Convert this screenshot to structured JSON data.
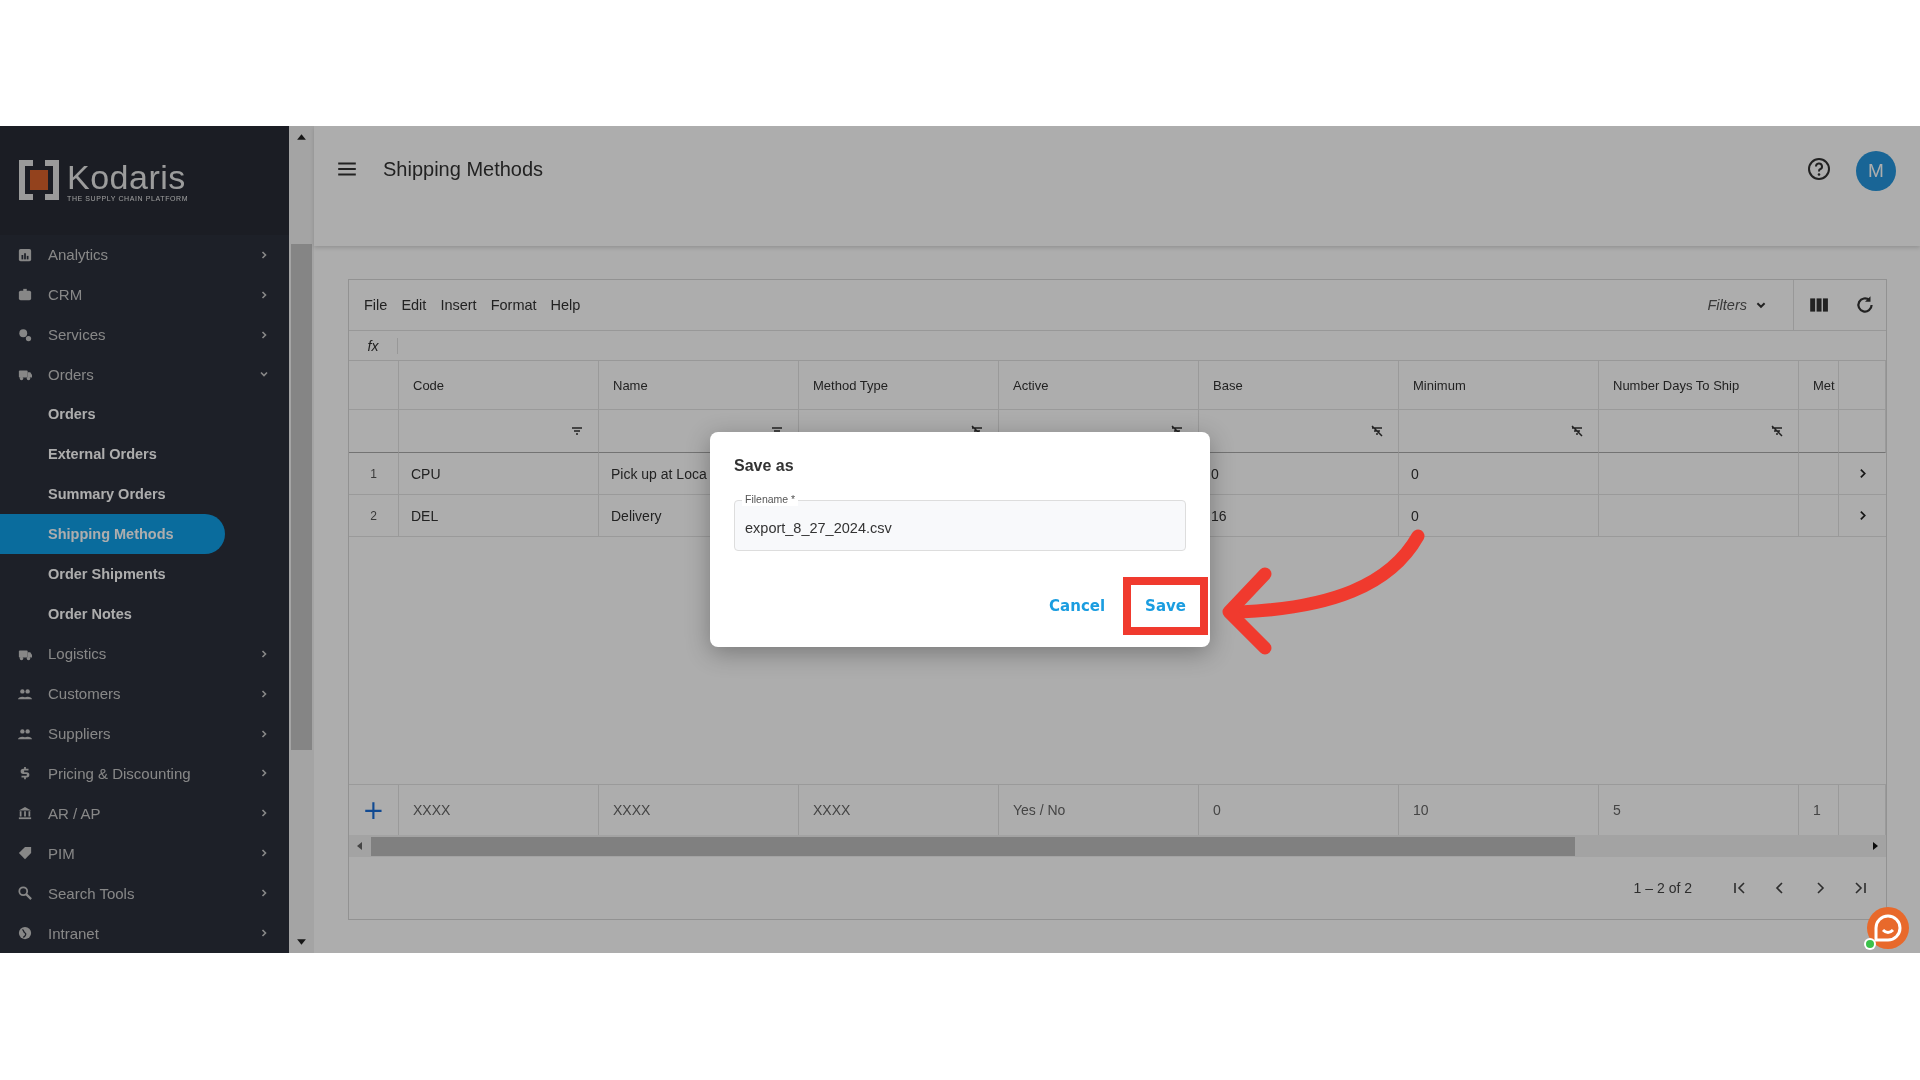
{
  "sidebar": {
    "logo": {
      "name": "Kodaris",
      "tagline": "THE SUPPLY CHAIN PLATFORM"
    },
    "items": [
      {
        "label": "Analytics",
        "expanded": false
      },
      {
        "label": "CRM",
        "expanded": false
      },
      {
        "label": "Services",
        "expanded": false
      },
      {
        "label": "Orders",
        "expanded": true,
        "children": [
          {
            "label": "Orders",
            "selected": false
          },
          {
            "label": "External Orders",
            "selected": false
          },
          {
            "label": "Summary Orders",
            "selected": false
          },
          {
            "label": "Shipping Methods",
            "selected": true
          },
          {
            "label": "Order Shipments",
            "selected": false
          },
          {
            "label": "Order Notes",
            "selected": false
          }
        ]
      },
      {
        "label": "Logistics",
        "expanded": false
      },
      {
        "label": "Customers",
        "expanded": false
      },
      {
        "label": "Suppliers",
        "expanded": false
      },
      {
        "label": "Pricing & Discounting",
        "expanded": false
      },
      {
        "label": "AR / AP",
        "expanded": false
      },
      {
        "label": "PIM",
        "expanded": false
      },
      {
        "label": "Search Tools",
        "expanded": false
      },
      {
        "label": "Intranet",
        "expanded": false
      }
    ]
  },
  "header": {
    "title": "Shipping Methods",
    "avatar": "M"
  },
  "toolbar": {
    "menu": [
      "File",
      "Edit",
      "Insert",
      "Format",
      "Help"
    ],
    "filters": "Filters"
  },
  "formula_bar": {
    "label": "fx"
  },
  "table": {
    "columns": [
      {
        "label": "Code",
        "kind": "filter"
      },
      {
        "label": "Name",
        "kind": "filter"
      },
      {
        "label": "Method Type",
        "kind": "filter-off"
      },
      {
        "label": "Active",
        "kind": "filter-off"
      },
      {
        "label": "Base",
        "kind": "filter-off"
      },
      {
        "label": "Minimum",
        "kind": "filter-off"
      },
      {
        "label": "Number Days To Ship",
        "kind": "filter-off"
      },
      {
        "label": "Met",
        "kind": "plain"
      }
    ],
    "rows": [
      {
        "number": "1",
        "cells": [
          "CPU",
          "Pick up at Loca",
          null,
          null,
          "0",
          "0",
          null,
          null
        ]
      },
      {
        "number": "2",
        "cells": [
          "DEL",
          "Delivery",
          null,
          null,
          "16",
          "0",
          null,
          null
        ]
      }
    ],
    "new_row": {
      "add": "+",
      "cells": [
        "XXXX",
        "XXXX",
        "XXXX",
        "Yes / No",
        "0",
        "10",
        "5",
        "1"
      ]
    },
    "pagination": "1 – 2 of 2"
  },
  "dialog": {
    "title": "Save as",
    "field": {
      "label": "Filename *",
      "value": "export_8_27_2024.csv"
    },
    "buttons": [
      {
        "label": "Cancel",
        "highlighted": false
      },
      {
        "label": "Save",
        "highlighted": true
      }
    ]
  }
}
